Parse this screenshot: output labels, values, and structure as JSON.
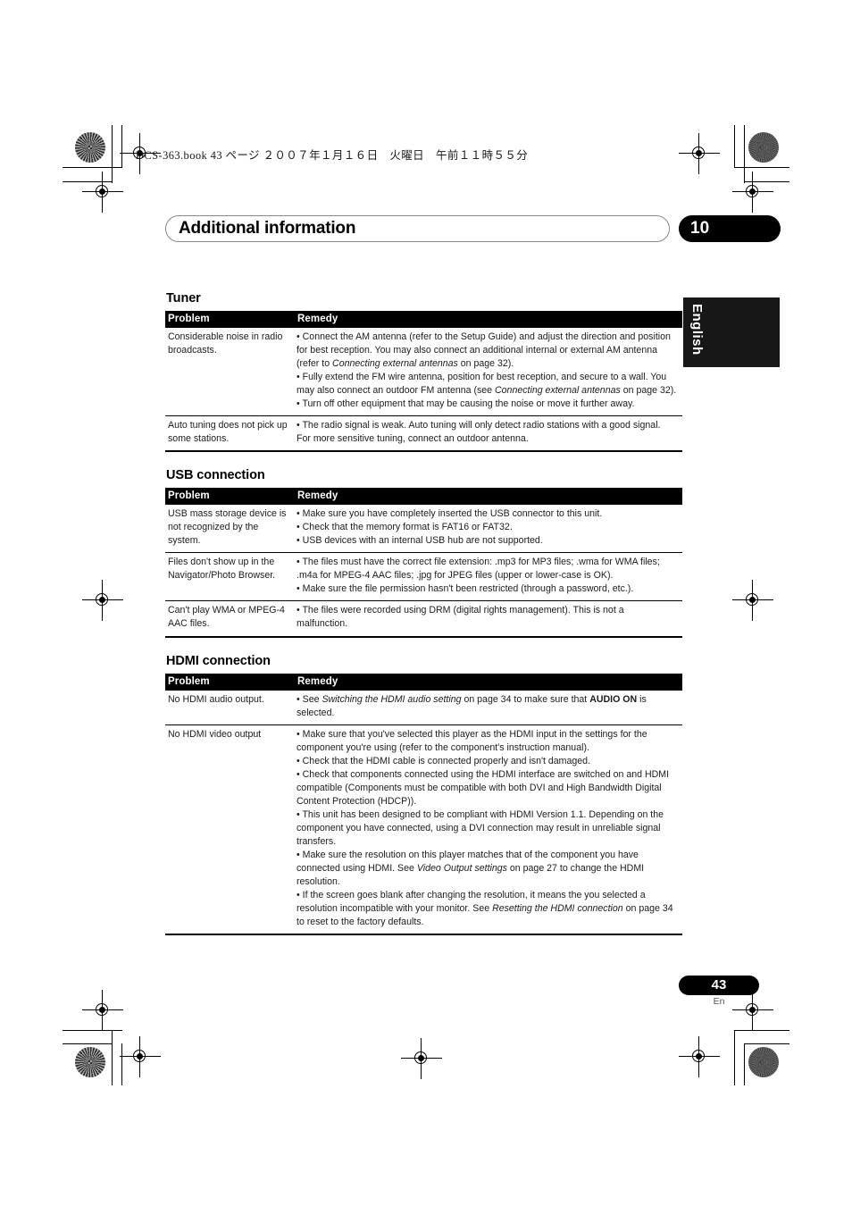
{
  "print_marks": {
    "file_stamp": "DCS-363.book   43 ページ   ２００７年１月１６日　火曜日　午前１１時５５分"
  },
  "header": {
    "chapter_title": "Additional information",
    "chapter_number": "10"
  },
  "side_tab": {
    "label": "English"
  },
  "footer": {
    "page_number": "43",
    "page_suffix": "En"
  },
  "sections": [
    {
      "title": "Tuner",
      "columns": [
        "Problem",
        "Remedy"
      ],
      "rows": [
        {
          "problem": "Considerable noise in radio broadcasts.",
          "remedy_html": "<span class=\"bullet-line\">• Connect the AM antenna (refer to the Setup Guide) and adjust the direction and position for best reception. You may also connect an additional internal or external AM antenna (refer to <em>Connecting external antennas</em> on page 32).</span><span class=\"bullet-line\">• Fully extend the FM wire antenna, position for best reception, and secure to a wall. You may also connect an outdoor FM antenna (see <em>Connecting external antennas</em> on page 32).</span><span class=\"bullet-line\">• Turn off other equipment that may be causing the noise or move it further away.</span>"
        },
        {
          "problem": "Auto tuning does not pick up some stations.",
          "remedy_html": "<span class=\"bullet-line\">• The radio signal is weak. Auto tuning will only detect radio stations with a good signal. For more sensitive tuning, connect an outdoor antenna.</span>"
        }
      ]
    },
    {
      "title": "USB connection",
      "columns": [
        "Problem",
        "Remedy"
      ],
      "rows": [
        {
          "problem": "USB mass storage device is not recognized by the system.",
          "remedy_html": "<span class=\"bullet-line\">• Make sure you have completely inserted the USB connector to this unit.</span><span class=\"bullet-line\">• Check that the memory format is FAT16 or FAT32.</span><span class=\"bullet-line\">• USB devices with an internal USB hub are not supported.</span>"
        },
        {
          "problem": "Files don't show up in the Navigator/Photo Browser.",
          "remedy_html": "<span class=\"bullet-line\">• The files must have the correct file extension: .mp3 for MP3 files; .wma for WMA files; .m4a for MPEG-4 AAC files; .jpg for JPEG files (upper or lower-case is OK).</span><span class=\"bullet-line\">• Make sure the file permission hasn't been restricted (through a password, etc.).</span>"
        },
        {
          "problem": "Can't play WMA or MPEG-4 AAC files.",
          "remedy_html": "<span class=\"bullet-line\">• The files were recorded using DRM (digital rights management). This is not a malfunction.</span>"
        }
      ]
    },
    {
      "title": "HDMI connection",
      "columns": [
        "Problem",
        "Remedy"
      ],
      "rows": [
        {
          "problem": "No HDMI audio output.",
          "remedy_html": "<span class=\"bullet-line\">• See <em>Switching the HDMI audio setting</em> on page 34 to make sure that <strong>AUDIO ON</strong> is selected.</span>"
        },
        {
          "problem": "No HDMI video output",
          "remedy_html": "<span class=\"bullet-line\">• Make sure that you've selected this player as the HDMI input in the settings for the component you're using (refer to the component's instruction manual).</span><span class=\"bullet-line\">• Check that the HDMI cable is connected properly and isn't damaged.</span><span class=\"bullet-line\">• Check that components connected using the HDMI interface are switched on and HDMI compatible (Components must be compatible with both DVI and High Bandwidth Digital Content Protection (HDCP)).</span><span class=\"bullet-line\">• This unit has been designed to be compliant with HDMI Version 1.1. Depending on the component you have connected, using a DVI connection may result in unreliable signal transfers.</span><span class=\"bullet-line\">• Make sure the resolution on this player matches that of the component you have connected using HDMI. See <em>Video Output settings</em> on page 27 to change the HDMI resolution.</span><span class=\"bullet-line\">• If the screen goes blank after changing the resolution, it means the you selected a resolution incompatible with your monitor. See <em>Resetting the HDMI connection</em> on page 34 to reset to the factory defaults.</span>"
        }
      ]
    }
  ]
}
